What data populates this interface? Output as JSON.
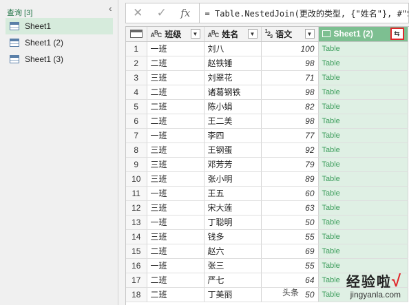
{
  "pane": {
    "header": "查询 [3]",
    "queries": [
      "Sheet1",
      "Sheet1 (2)",
      "Sheet1 (3)"
    ],
    "selected": "Sheet1"
  },
  "formula_bar": {
    "cancel_icon": "✕",
    "confirm_icon": "✓",
    "fx_label": "fx",
    "text": "= Table.NestedJoin(更改的类型, {\"姓名\"}, #\"Sh"
  },
  "columns": [
    {
      "type": "ABC",
      "label": "班级"
    },
    {
      "type": "ABC",
      "label": "姓名"
    },
    {
      "type": "123",
      "label": "语文"
    },
    {
      "type": "table",
      "label": "Sheet1 (2)"
    }
  ],
  "rows": [
    {
      "n": "1",
      "c1": "一班",
      "c2": "刘八",
      "c3": "100",
      "c4": "Table"
    },
    {
      "n": "2",
      "c1": "二班",
      "c2": "赵铁锤",
      "c3": "98",
      "c4": "Table"
    },
    {
      "n": "3",
      "c1": "三班",
      "c2": "刘翠花",
      "c3": "71",
      "c4": "Table"
    },
    {
      "n": "4",
      "c1": "二班",
      "c2": "诸葛钢铁",
      "c3": "98",
      "c4": "Table"
    },
    {
      "n": "5",
      "c1": "二班",
      "c2": "陈小娟",
      "c3": "82",
      "c4": "Table"
    },
    {
      "n": "6",
      "c1": "二班",
      "c2": "王二美",
      "c3": "98",
      "c4": "Table"
    },
    {
      "n": "7",
      "c1": "一班",
      "c2": "李四",
      "c3": "77",
      "c4": "Table"
    },
    {
      "n": "8",
      "c1": "三班",
      "c2": "王钢蛋",
      "c3": "92",
      "c4": "Table"
    },
    {
      "n": "9",
      "c1": "三班",
      "c2": "邓芳芳",
      "c3": "79",
      "c4": "Table"
    },
    {
      "n": "10",
      "c1": "三班",
      "c2": "张小明",
      "c3": "89",
      "c4": "Table"
    },
    {
      "n": "11",
      "c1": "一班",
      "c2": "王五",
      "c3": "60",
      "c4": "Table"
    },
    {
      "n": "12",
      "c1": "三班",
      "c2": "宋大莲",
      "c3": "63",
      "c4": "Table"
    },
    {
      "n": "13",
      "c1": "一班",
      "c2": "丁聪明",
      "c3": "50",
      "c4": "Table"
    },
    {
      "n": "14",
      "c1": "三班",
      "c2": "钱多",
      "c3": "55",
      "c4": "Table"
    },
    {
      "n": "15",
      "c1": "二班",
      "c2": "赵六",
      "c3": "69",
      "c4": "Table"
    },
    {
      "n": "16",
      "c1": "一班",
      "c2": "张三",
      "c3": "55",
      "c4": "Table"
    },
    {
      "n": "17",
      "c1": "二班",
      "c2": "严七",
      "c3": "64",
      "c4": "Table"
    },
    {
      "n": "18",
      "c1": "二班",
      "c2": "丁美丽",
      "c3": "50",
      "c4": "Table"
    }
  ],
  "watermark": {
    "brand": "经验啦",
    "url": "jingyanla.com",
    "source": "头条"
  },
  "colors": {
    "accent_green": "#217346",
    "table_column_fill": "#dff0e4",
    "table_header_fill": "#7dbf91",
    "highlight_box": "#e0262b"
  }
}
